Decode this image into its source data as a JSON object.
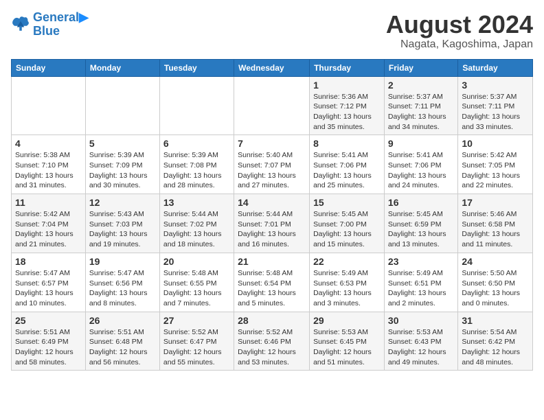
{
  "header": {
    "logo_line1": "General",
    "logo_line2": "Blue",
    "month_title": "August 2024",
    "location": "Nagata, Kagoshima, Japan"
  },
  "days_of_week": [
    "Sunday",
    "Monday",
    "Tuesday",
    "Wednesday",
    "Thursday",
    "Friday",
    "Saturday"
  ],
  "weeks": [
    [
      {
        "day": "",
        "detail": ""
      },
      {
        "day": "",
        "detail": ""
      },
      {
        "day": "",
        "detail": ""
      },
      {
        "day": "",
        "detail": ""
      },
      {
        "day": "1",
        "detail": "Sunrise: 5:36 AM\nSunset: 7:12 PM\nDaylight: 13 hours\nand 35 minutes."
      },
      {
        "day": "2",
        "detail": "Sunrise: 5:37 AM\nSunset: 7:11 PM\nDaylight: 13 hours\nand 34 minutes."
      },
      {
        "day": "3",
        "detail": "Sunrise: 5:37 AM\nSunset: 7:11 PM\nDaylight: 13 hours\nand 33 minutes."
      }
    ],
    [
      {
        "day": "4",
        "detail": "Sunrise: 5:38 AM\nSunset: 7:10 PM\nDaylight: 13 hours\nand 31 minutes."
      },
      {
        "day": "5",
        "detail": "Sunrise: 5:39 AM\nSunset: 7:09 PM\nDaylight: 13 hours\nand 30 minutes."
      },
      {
        "day": "6",
        "detail": "Sunrise: 5:39 AM\nSunset: 7:08 PM\nDaylight: 13 hours\nand 28 minutes."
      },
      {
        "day": "7",
        "detail": "Sunrise: 5:40 AM\nSunset: 7:07 PM\nDaylight: 13 hours\nand 27 minutes."
      },
      {
        "day": "8",
        "detail": "Sunrise: 5:41 AM\nSunset: 7:06 PM\nDaylight: 13 hours\nand 25 minutes."
      },
      {
        "day": "9",
        "detail": "Sunrise: 5:41 AM\nSunset: 7:06 PM\nDaylight: 13 hours\nand 24 minutes."
      },
      {
        "day": "10",
        "detail": "Sunrise: 5:42 AM\nSunset: 7:05 PM\nDaylight: 13 hours\nand 22 minutes."
      }
    ],
    [
      {
        "day": "11",
        "detail": "Sunrise: 5:42 AM\nSunset: 7:04 PM\nDaylight: 13 hours\nand 21 minutes."
      },
      {
        "day": "12",
        "detail": "Sunrise: 5:43 AM\nSunset: 7:03 PM\nDaylight: 13 hours\nand 19 minutes."
      },
      {
        "day": "13",
        "detail": "Sunrise: 5:44 AM\nSunset: 7:02 PM\nDaylight: 13 hours\nand 18 minutes."
      },
      {
        "day": "14",
        "detail": "Sunrise: 5:44 AM\nSunset: 7:01 PM\nDaylight: 13 hours\nand 16 minutes."
      },
      {
        "day": "15",
        "detail": "Sunrise: 5:45 AM\nSunset: 7:00 PM\nDaylight: 13 hours\nand 15 minutes."
      },
      {
        "day": "16",
        "detail": "Sunrise: 5:45 AM\nSunset: 6:59 PM\nDaylight: 13 hours\nand 13 minutes."
      },
      {
        "day": "17",
        "detail": "Sunrise: 5:46 AM\nSunset: 6:58 PM\nDaylight: 13 hours\nand 11 minutes."
      }
    ],
    [
      {
        "day": "18",
        "detail": "Sunrise: 5:47 AM\nSunset: 6:57 PM\nDaylight: 13 hours\nand 10 minutes."
      },
      {
        "day": "19",
        "detail": "Sunrise: 5:47 AM\nSunset: 6:56 PM\nDaylight: 13 hours\nand 8 minutes."
      },
      {
        "day": "20",
        "detail": "Sunrise: 5:48 AM\nSunset: 6:55 PM\nDaylight: 13 hours\nand 7 minutes."
      },
      {
        "day": "21",
        "detail": "Sunrise: 5:48 AM\nSunset: 6:54 PM\nDaylight: 13 hours\nand 5 minutes."
      },
      {
        "day": "22",
        "detail": "Sunrise: 5:49 AM\nSunset: 6:53 PM\nDaylight: 13 hours\nand 3 minutes."
      },
      {
        "day": "23",
        "detail": "Sunrise: 5:49 AM\nSunset: 6:51 PM\nDaylight: 13 hours\nand 2 minutes."
      },
      {
        "day": "24",
        "detail": "Sunrise: 5:50 AM\nSunset: 6:50 PM\nDaylight: 13 hours\nand 0 minutes."
      }
    ],
    [
      {
        "day": "25",
        "detail": "Sunrise: 5:51 AM\nSunset: 6:49 PM\nDaylight: 12 hours\nand 58 minutes."
      },
      {
        "day": "26",
        "detail": "Sunrise: 5:51 AM\nSunset: 6:48 PM\nDaylight: 12 hours\nand 56 minutes."
      },
      {
        "day": "27",
        "detail": "Sunrise: 5:52 AM\nSunset: 6:47 PM\nDaylight: 12 hours\nand 55 minutes."
      },
      {
        "day": "28",
        "detail": "Sunrise: 5:52 AM\nSunset: 6:46 PM\nDaylight: 12 hours\nand 53 minutes."
      },
      {
        "day": "29",
        "detail": "Sunrise: 5:53 AM\nSunset: 6:45 PM\nDaylight: 12 hours\nand 51 minutes."
      },
      {
        "day": "30",
        "detail": "Sunrise: 5:53 AM\nSunset: 6:43 PM\nDaylight: 12 hours\nand 49 minutes."
      },
      {
        "day": "31",
        "detail": "Sunrise: 5:54 AM\nSunset: 6:42 PM\nDaylight: 12 hours\nand 48 minutes."
      }
    ]
  ]
}
